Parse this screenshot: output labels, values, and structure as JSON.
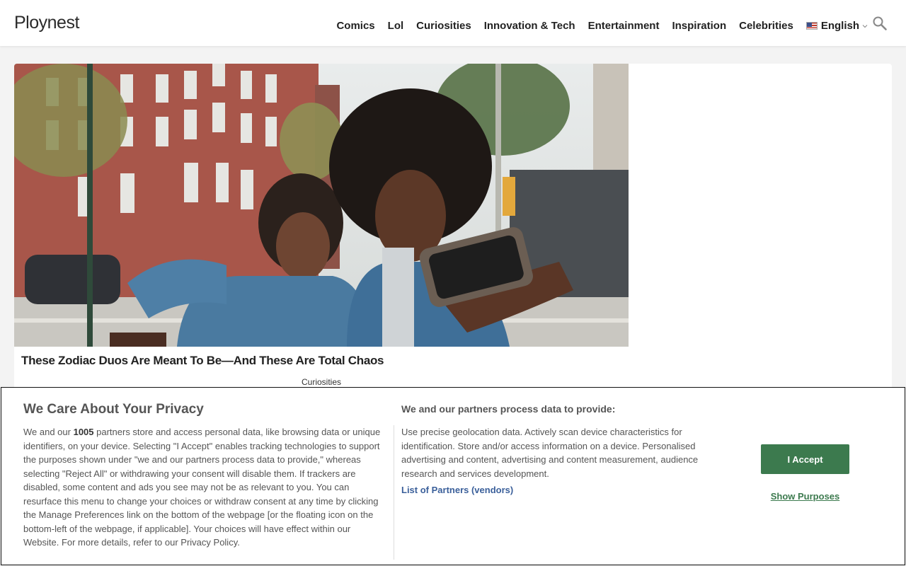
{
  "header": {
    "logo": "Ploynest",
    "nav": [
      "Comics",
      "Lol",
      "Curiosities",
      "Innovation & Tech",
      "Entertainment",
      "Inspiration",
      "Celebrities"
    ],
    "language": "English",
    "icons": {
      "flag": "us-flag-icon",
      "chevron": "chevron-down-icon",
      "search": "search-icon"
    }
  },
  "article": {
    "title": "These Zodiac Duos Are Meant To Be—And These Are Total Chaos",
    "category": "Curiosities",
    "image": "photo-two-people-taking-selfie-on-city-street"
  },
  "consent": {
    "title": "We Care About Your Privacy",
    "body_prefix": "We and our ",
    "partner_count": "1005",
    "body_suffix": " partners store and access personal data, like browsing data or unique identifiers, on your device. Selecting \"I Accept\" enables tracking technologies to support the purposes shown under \"we and our partners process data to provide,\" whereas selecting \"Reject All\" or withdrawing your consent will disable them. If trackers are disabled, some content and ads you see may not be as relevant to you. You can resurface this menu to change your choices or withdraw consent at any time by clicking the Manage Preferences link on the bottom of the webpage [or the floating icon on the bottom-left of the webpage, if applicable]. Your choices will have effect within our Website. For more details, refer to our Privacy Policy.",
    "subtitle": "We and our partners process data to provide:",
    "purposes": "Use precise geolocation data. Actively scan device characteristics for identification. Store and/or access information on a device. Personalised advertising and content, advertising and content measurement, audience research and services development.",
    "partners_link": "List of Partners (vendors)",
    "accept_label": "I Accept",
    "show_purposes_label": "Show Purposes"
  },
  "colors": {
    "accent_green": "#3c7a4e",
    "link_blue": "#3a5f9a",
    "page_bg": "#f3f3f3"
  }
}
